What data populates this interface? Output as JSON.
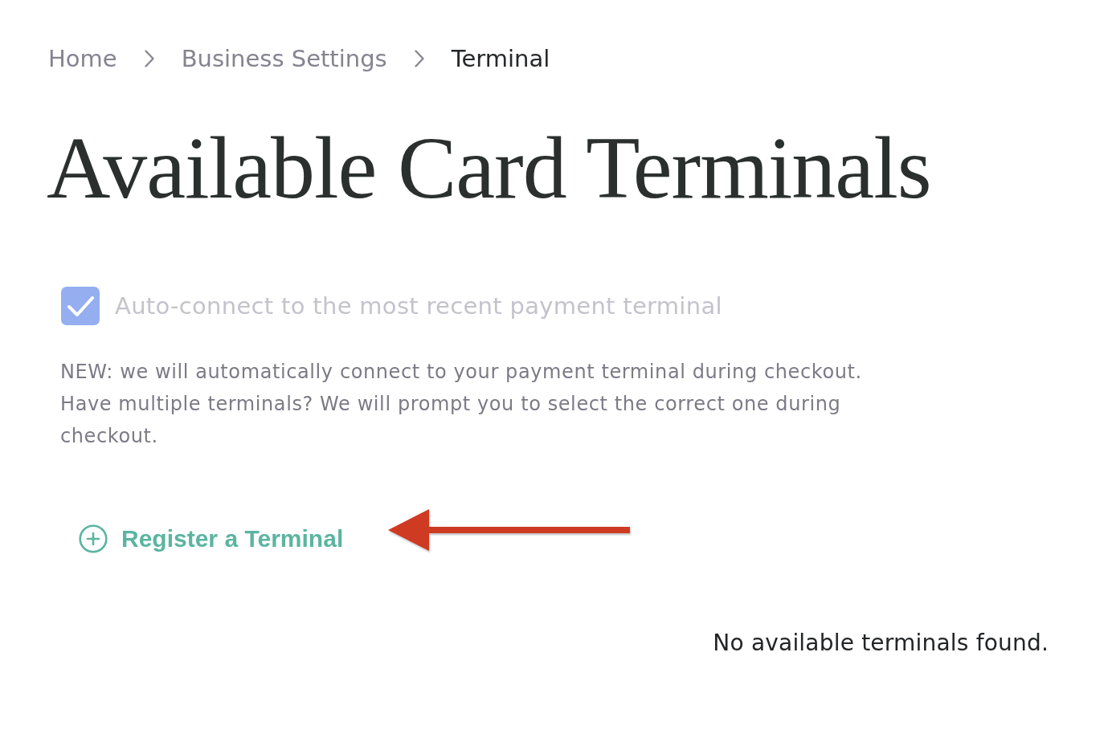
{
  "breadcrumb": [
    {
      "label": "Home",
      "current": false
    },
    {
      "label": "Business Settings",
      "current": false
    },
    {
      "label": "Terminal",
      "current": true
    }
  ],
  "title": "Available Card Terminals",
  "auto_connect": {
    "label": "Auto-connect to the most recent payment terminal",
    "checked": true,
    "disabled": true
  },
  "description": "NEW: we will automatically connect to your payment terminal during checkout. Have multiple terminals? We will prompt you to select the correct one during checkout.",
  "register_button": {
    "label": "Register a Terminal"
  },
  "empty_message": "No available terminals found."
}
